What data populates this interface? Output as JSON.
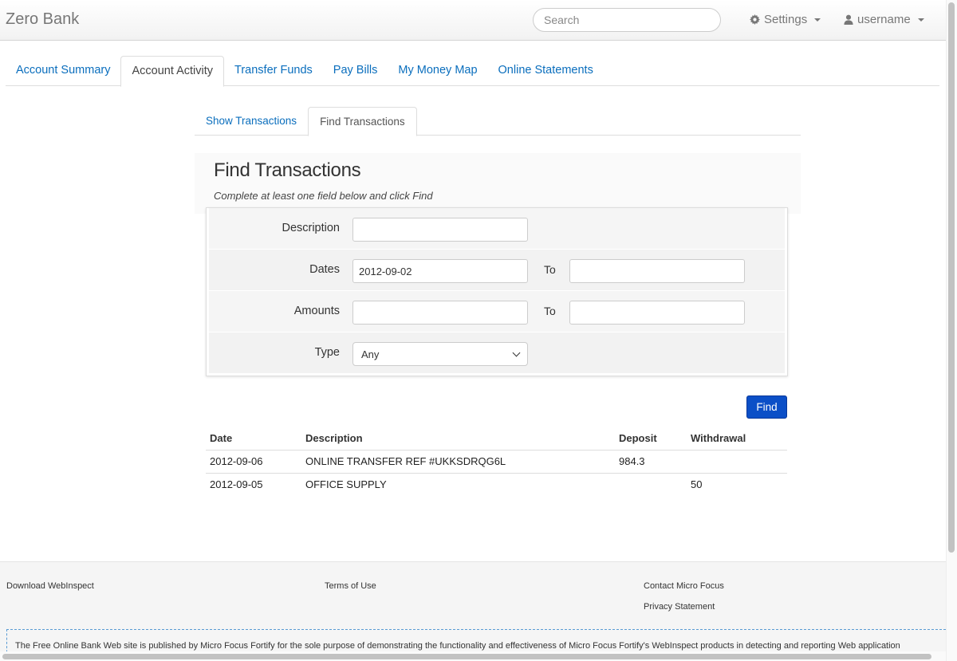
{
  "brand": "Zero Bank",
  "search": {
    "placeholder": "Search"
  },
  "navbar": {
    "settings_label": "Settings",
    "user_label": "username"
  },
  "main_tabs": [
    {
      "label": "Account Summary",
      "active": false
    },
    {
      "label": "Account Activity",
      "active": true
    },
    {
      "label": "Transfer Funds",
      "active": false
    },
    {
      "label": "Pay Bills",
      "active": false
    },
    {
      "label": "My Money Map",
      "active": false
    },
    {
      "label": "Online Statements",
      "active": false
    }
  ],
  "sub_tabs": [
    {
      "label": "Show Transactions",
      "active": false
    },
    {
      "label": "Find Transactions",
      "active": true
    }
  ],
  "find": {
    "title": "Find Transactions",
    "subtitle": "Complete at least one field below and click Find",
    "description_label": "Description",
    "description_value": "",
    "dates_label": "Dates",
    "date_from": "2012-09-02",
    "date_to": "",
    "to_label": "To",
    "amounts_label": "Amounts",
    "amount_from": "",
    "amount_to": "",
    "type_label": "Type",
    "type_value": "Any",
    "find_button": "Find"
  },
  "results": {
    "headers": [
      "Date",
      "Description",
      "Deposit",
      "Withdrawal"
    ],
    "rows": [
      [
        "2012-09-06",
        "ONLINE TRANSFER REF #UKKSDRQG6L",
        "984.3",
        ""
      ],
      [
        "2012-09-05",
        "OFFICE SUPPLY",
        "",
        "50"
      ]
    ]
  },
  "footer": {
    "download": "Download WebInspect",
    "terms": "Terms of Use",
    "contact": "Contact Micro Focus",
    "privacy": "Privacy Statement",
    "disclaimer": "The Free Online Bank Web site is published by Micro Focus Fortify for the sole purpose of demonstrating the functionality and effectiveness of Micro Focus Fortify's WebInspect products in detecting and reporting Web application"
  }
}
